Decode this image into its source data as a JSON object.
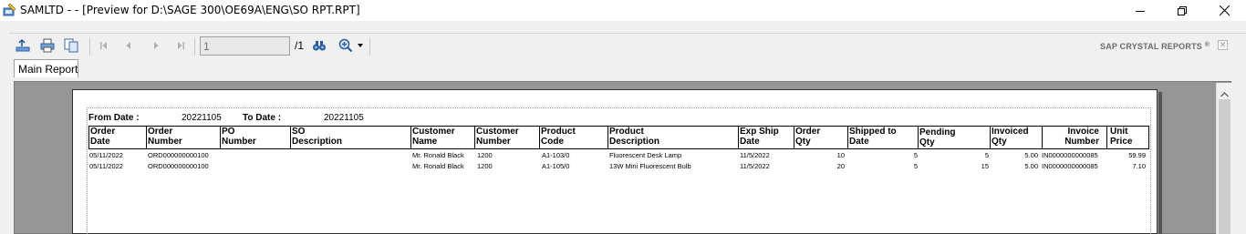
{
  "window": {
    "title": "SAMLTD -  - [Preview for D:\\SAGE 300\\OE69A\\ENG\\SO RPT.RPT]"
  },
  "toolbar": {
    "icons": [
      "export-icon",
      "print-icon",
      "copy-icon",
      "first-page-icon",
      "previous-page-icon",
      "next-page-icon",
      "last-page-icon",
      "find-icon",
      "zoom-icon"
    ],
    "page_value": "1",
    "page_total": "/1",
    "brand": "SAP CRYSTAL REPORTS",
    "brand_mark": "®"
  },
  "tabs": [
    {
      "label": "Main Report"
    }
  ],
  "report": {
    "from_label": "From Date :",
    "from_value": "20221105",
    "to_label": "To Date :",
    "to_value": "20221105",
    "headers": {
      "order_date": [
        "Order",
        "Date"
      ],
      "order_number": [
        "Order",
        "Number"
      ],
      "po_number": [
        "PO",
        "Number"
      ],
      "so_description": [
        "SO",
        "Description"
      ],
      "customer_name": [
        "Customer",
        "Name"
      ],
      "customer_number": [
        "Customer",
        "Number"
      ],
      "product_code": [
        "Product",
        "Code"
      ],
      "product_description": [
        "Product",
        "Description"
      ],
      "exp_ship_date": [
        "Exp Ship",
        "Date"
      ],
      "order_qty": [
        "Order",
        "Qty"
      ],
      "shipped_to_date": [
        "Shipped to",
        "Date"
      ],
      "pending_qty": [
        "Pending",
        "Qty"
      ],
      "invoiced_qty": [
        "Invoiced",
        "Qty"
      ],
      "invoice_number": [
        "Invoice",
        "Number"
      ],
      "unit_price": [
        "Unit",
        "Price"
      ]
    },
    "rows": [
      {
        "order_date": "05/11/2022",
        "order_number": "ORD000000000100",
        "po_number": "",
        "so_description": "",
        "customer_name": "Mr. Ronald Black",
        "customer_number": "1200",
        "product_code": "A1-103/0",
        "product_description": "Fluorescent Desk Lamp",
        "exp_ship_date": "11/5/2022",
        "order_qty": "10",
        "shipped_to_date": "5",
        "pending_qty": "5",
        "invoiced_qty": "5.00",
        "invoice_number": "IN0000000000085",
        "unit_price": "59.99"
      },
      {
        "order_date": "05/11/2022",
        "order_number": "ORD000000000100",
        "po_number": "",
        "so_description": "",
        "customer_name": "Mr. Ronald Black",
        "customer_number": "1200",
        "product_code": "A1-105/0",
        "product_description": "13W Mini Fluorescent Bulb",
        "exp_ship_date": "11/5/2022",
        "order_qty": "20",
        "shipped_to_date": "5",
        "pending_qty": "15",
        "invoiced_qty": "5.00",
        "invoice_number": "IN0000000000085",
        "unit_price": "7.10"
      }
    ]
  }
}
